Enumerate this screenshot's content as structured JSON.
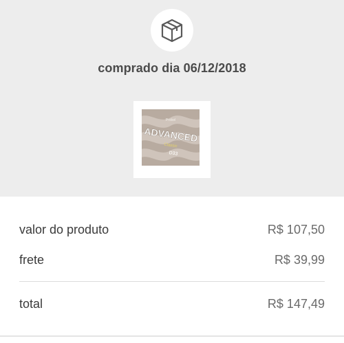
{
  "order": {
    "purchase_date_text": "comprado dia 06/12/2018",
    "icon": "package-box-icon",
    "product_image_text": "ADVANCED",
    "product_image_subtext": "D33"
  },
  "summary": {
    "product_label": "valor do produto",
    "product_value": "R$ 107,50",
    "shipping_label": "frete",
    "shipping_value": "R$ 39,99",
    "total_label": "total",
    "total_value": "R$ 147,49"
  },
  "colors": {
    "header_background": "#ededed",
    "text": "#3a3a3a",
    "value_text": "#6a6a6a"
  }
}
